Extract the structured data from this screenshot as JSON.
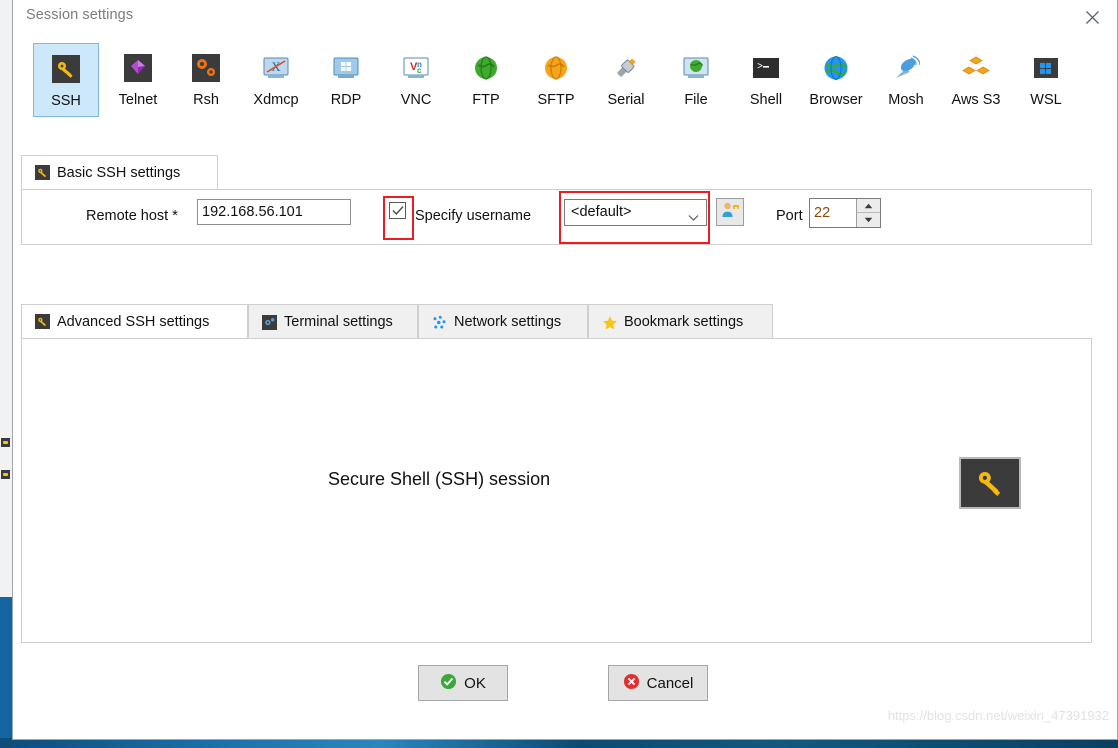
{
  "window": {
    "title": "Session settings",
    "close_icon": "close-icon"
  },
  "session_types": [
    {
      "label": "SSH",
      "icon": "ssh-key-icon",
      "selected": true
    },
    {
      "label": "Telnet",
      "icon": "telnet-gem-icon",
      "selected": false
    },
    {
      "label": "Rsh",
      "icon": "rsh-gears-icon",
      "selected": false
    },
    {
      "label": "Xdmcp",
      "icon": "xdmcp-monitor-icon",
      "selected": false
    },
    {
      "label": "RDP",
      "icon": "rdp-monitor-icon",
      "selected": false
    },
    {
      "label": "VNC",
      "icon": "vnc-monitor-icon",
      "selected": false
    },
    {
      "label": "FTP",
      "icon": "ftp-globe-icon",
      "selected": false
    },
    {
      "label": "SFTP",
      "icon": "sftp-globe-icon",
      "selected": false
    },
    {
      "label": "Serial",
      "icon": "serial-plug-icon",
      "selected": false
    },
    {
      "label": "File",
      "icon": "file-monitor-icon",
      "selected": false
    },
    {
      "label": "Shell",
      "icon": "shell-terminal-icon",
      "selected": false
    },
    {
      "label": "Browser",
      "icon": "browser-globe-icon",
      "selected": false
    },
    {
      "label": "Mosh",
      "icon": "mosh-dish-icon",
      "selected": false
    },
    {
      "label": "Aws S3",
      "icon": "aws-s3-cubes-icon",
      "selected": false
    },
    {
      "label": "WSL",
      "icon": "wsl-windows-icon",
      "selected": false
    }
  ],
  "basic_group": {
    "tab_label": "Basic SSH settings",
    "tab_icon": "ssh-key-icon",
    "remote_host": {
      "label": "Remote host *",
      "value": "192.168.56.101",
      "placeholder": ""
    },
    "specify_username": {
      "label": "Specify username",
      "checked": true,
      "check_icon": "check-icon"
    },
    "username_select": {
      "value": "<default>",
      "arrow_icon": "chevron-down-icon"
    },
    "user_browse_button": {
      "icon": "user-key-icon"
    },
    "port": {
      "label": "Port",
      "value": "22",
      "up_icon": "caret-up-icon",
      "down_icon": "caret-down-icon"
    }
  },
  "advanced_group": {
    "tabs": [
      {
        "label": "Advanced SSH settings",
        "icon": "ssh-key-icon",
        "active": true
      },
      {
        "label": "Terminal settings",
        "icon": "terminal-gear-icon",
        "active": false
      },
      {
        "label": "Network settings",
        "icon": "network-dots-icon",
        "active": false
      },
      {
        "label": "Bookmark settings",
        "icon": "star-icon",
        "active": false
      }
    ],
    "panel": {
      "session_title": "Secure Shell (SSH) session",
      "big_icon": "ssh-key-icon"
    }
  },
  "buttons": {
    "ok": {
      "label": "OK",
      "icon": "check-circle-icon"
    },
    "cancel": {
      "label": "Cancel",
      "icon": "x-circle-icon"
    }
  },
  "watermark": "https://blog.csdn.net/weixin_47391932",
  "colors": {
    "selected_tab_bg": "#cde8fb",
    "selected_tab_border": "#7eb9e0",
    "annotation_red": "#ec1c24",
    "ok_green": "#3aa93a",
    "cancel_red": "#e03131",
    "port_value": "#8a4b10",
    "title_gray": "#7c7c7c"
  }
}
